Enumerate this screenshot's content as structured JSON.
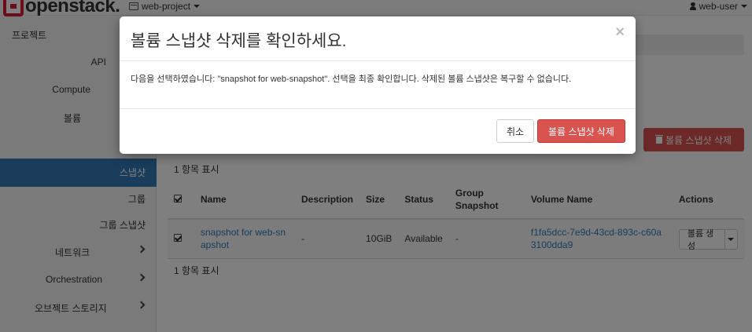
{
  "navbar": {
    "brand": "openstack.",
    "project": "web-project",
    "user": "web-user"
  },
  "sidebar": {
    "project_header": "프로젝트",
    "api": "API",
    "compute": "Compute",
    "volume": "볼륨",
    "snapshot": "스냅샷",
    "group": "그룹",
    "group_snapshot": "그룹 스냅샷",
    "network": "네트워크",
    "orchestration": "Orchestration",
    "object_storage": "오브젝트 스토리지"
  },
  "main": {
    "delete_button": "볼륨 스냅샷 삭제",
    "count_top": "1 항목 표시",
    "count_bottom": "1 항목 표시",
    "columns": [
      "Name",
      "Description",
      "Size",
      "Status",
      "Group Snapshot",
      "Volume Name",
      "Actions"
    ],
    "rows": [
      {
        "name": "snapshot for web-snapshot",
        "description": "-",
        "size": "10GiB",
        "status": "Available",
        "group_snapshot": "-",
        "volume_name": "f1fa5dcc-7e9d-43cd-893c-c60a3100dda9",
        "action": "볼륨 생성"
      }
    ]
  },
  "modal": {
    "title": "볼륨 스냅샷 삭제를 확인하세요.",
    "close": "×",
    "message": "다음을 선택하였습니다: \"snapshot for web-snapshot\". 선택을 최종 확인합니다. 삭제된 볼륨 스냅샷은 복구할 수 없습니다.",
    "cancel": "취소",
    "confirm": "볼륨 스냅샷 삭제"
  },
  "colors": {
    "danger": "#d9534f",
    "primary": "#337ab7",
    "brand": "#da1a32"
  }
}
